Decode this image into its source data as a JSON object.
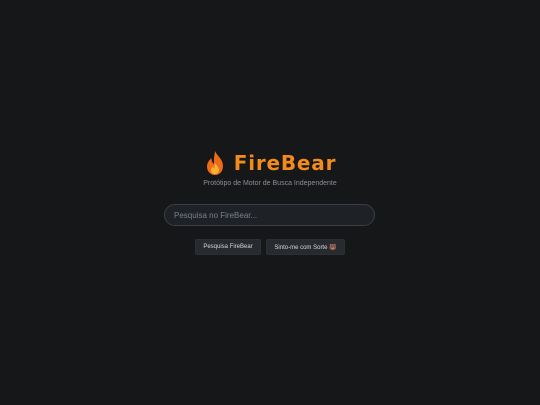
{
  "logo": {
    "icon": "fire-icon",
    "name": "FireBear",
    "subtitle": "Protótipo de Motor de Busca Independente",
    "accent_color": "#f28a1c"
  },
  "search": {
    "placeholder": "Pesquisa no FireBear...",
    "value": ""
  },
  "buttons": {
    "search_label": "Pesquisa FireBear",
    "lucky_label": "Sinto-me com Sorte 🐻"
  },
  "colors": {
    "background": "#151719",
    "button_background": "#272b30",
    "input_background": "#1e2226"
  }
}
